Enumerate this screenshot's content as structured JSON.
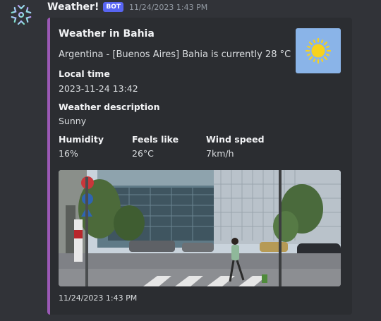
{
  "message": {
    "username": "Weather!",
    "bot_tag": "BOT",
    "timestamp": "11/24/2023 1:43 PM"
  },
  "embed": {
    "accent_color": "#9b59b6",
    "title": "Weather in Bahia",
    "description": "Argentina - [Buenos Aires] Bahia is currently 28 °C",
    "thumbnail_icon": "sun-icon",
    "fields": {
      "local_time": {
        "name": "Local time",
        "value": "2023-11-24 13:42"
      },
      "weather_description": {
        "name": "Weather description",
        "value": "Sunny"
      },
      "humidity": {
        "name": "Humidity",
        "value": "16%"
      },
      "feels_like": {
        "name": "Feels like",
        "value": "26°C"
      },
      "wind_speed": {
        "name": "Wind speed",
        "value": "7km/h"
      }
    },
    "image": "city-street-photo",
    "footer": "11/24/2023 1:43 PM"
  },
  "avatar_icon": "snowflake-icon"
}
